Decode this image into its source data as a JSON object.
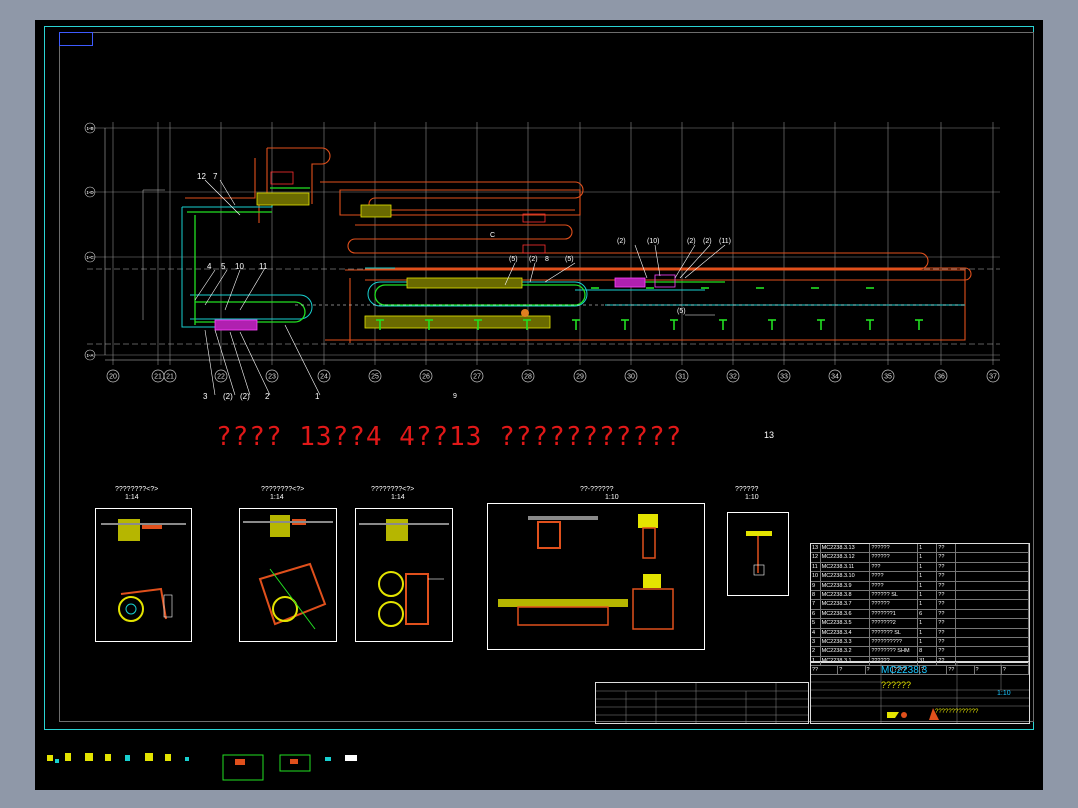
{
  "title_note": "???? 13??4   4??13   ???????????",
  "code_label": "13",
  "section_label": "9",
  "grid": {
    "axis_numbers": [
      "20",
      "21",
      "21",
      "22",
      "23",
      "24",
      "25",
      "26",
      "27",
      "28",
      "29",
      "30",
      "31",
      "32",
      "33",
      "34",
      "35",
      "36",
      "37"
    ],
    "row_labels": [
      "1-B",
      "1-D",
      "1-C",
      "1-A"
    ]
  },
  "callouts_left": [
    "12",
    "7",
    "4",
    "5",
    "10",
    "11",
    "3",
    "(2)",
    "(2)",
    "2",
    "1"
  ],
  "callouts_right": [
    "(2)",
    "(10)",
    "(2)",
    "(2)",
    "(11)",
    "(5)",
    "(2)",
    "8",
    "(5)",
    "(5)"
  ],
  "callout_C": "C",
  "details": [
    {
      "title": "????????<?>",
      "scale": "1:14"
    },
    {
      "title": "????????<?>",
      "scale": "1:14"
    },
    {
      "title": "????????<?>",
      "scale": "1:14"
    },
    {
      "title": "??-??????",
      "scale": "1:10"
    },
    {
      "title": "??????",
      "scale": "1:10"
    }
  ],
  "bom": {
    "rows": [
      {
        "no": "13",
        "code": "MC2238.3.13",
        "name": "??????",
        "qty": "1",
        "mat": "??"
      },
      {
        "no": "12",
        "code": "MC2238.3.12",
        "name": "??????",
        "qty": "1",
        "mat": "??"
      },
      {
        "no": "11",
        "code": "MC2238.3.11",
        "name": "???",
        "qty": "1",
        "mat": "??"
      },
      {
        "no": "10",
        "code": "MC2238.3.10",
        "name": "????",
        "qty": "1",
        "mat": "??"
      },
      {
        "no": "9",
        "code": "MC2238.3.9",
        "name": "????",
        "qty": "1",
        "mat": "??"
      },
      {
        "no": "8",
        "code": "MC2238.3.8",
        "name": "?????? SL",
        "qty": "1",
        "mat": "??"
      },
      {
        "no": "7",
        "code": "MC2238.3.7",
        "name": "??????",
        "qty": "1",
        "mat": "??"
      },
      {
        "no": "6",
        "code": "MC2238.3.6",
        "name": "???????1",
        "qty": "6",
        "mat": "??"
      },
      {
        "no": "5",
        "code": "MC2238.3.5",
        "name": "???????2",
        "qty": "1",
        "mat": "??"
      },
      {
        "no": "4",
        "code": "MC2238.3.4",
        "name": "??????? SL",
        "qty": "1",
        "mat": "??"
      },
      {
        "no": "3",
        "code": "MC2238.3.3",
        "name": "??????????",
        "qty": "1",
        "mat": "??"
      },
      {
        "no": "2",
        "code": "MC2238.3.2",
        "name": "???????? SHM",
        "qty": "8",
        "mat": "??"
      },
      {
        "no": "1",
        "code": "MC2238.3.1",
        "name": "??????",
        "qty": "31",
        "mat": "??"
      }
    ],
    "header": [
      "??",
      "?",
      "?",
      "????",
      "?",
      "??",
      "?",
      "?"
    ]
  },
  "title_block": {
    "project_no": "MC2238.3",
    "drawing_name": "??????",
    "scale": "1:10",
    "company": "?????????????"
  },
  "colors": {
    "frame": "#2ad3d3",
    "track_orange": "#e0501c",
    "track_cyan": "#18d0d0",
    "conveyor_green": "#22e022",
    "grid_gray": "#8a8a8a",
    "red_text": "#e01818"
  }
}
